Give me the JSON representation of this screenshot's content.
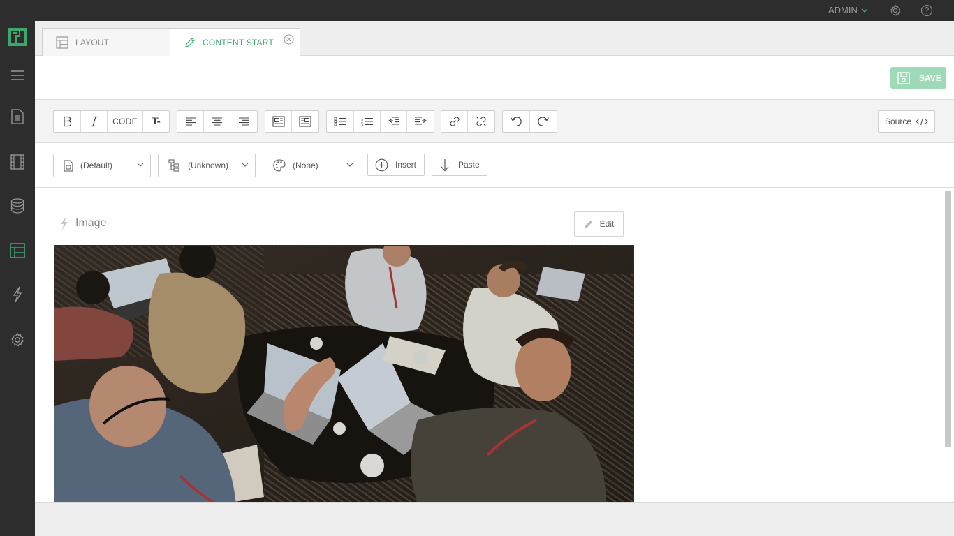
{
  "topbar": {
    "user_label": "ADMIN",
    "icons": [
      "chevron-down-icon",
      "gear-icon",
      "help-icon"
    ]
  },
  "sidebar": {
    "items": [
      {
        "name": "menu",
        "icon": "hamburger-icon",
        "active": false
      },
      {
        "name": "pages",
        "icon": "document-icon",
        "active": false
      },
      {
        "name": "media",
        "icon": "film-icon",
        "active": false
      },
      {
        "name": "data",
        "icon": "database-icon",
        "active": false
      },
      {
        "name": "layouts",
        "icon": "layout-icon",
        "active": true
      },
      {
        "name": "actions",
        "icon": "lightning-icon",
        "active": false
      },
      {
        "name": "settings",
        "icon": "gear-icon",
        "active": false
      }
    ]
  },
  "tabs": [
    {
      "label": "LAYOUT",
      "active": false
    },
    {
      "label": "CONTENT START",
      "active": true
    }
  ],
  "header": {
    "save_label": "SAVE"
  },
  "toolbar": {
    "code_label": "CODE",
    "clear_format_label": "T-",
    "source_label": "Source"
  },
  "toolbar2": {
    "style_select": "(Default)",
    "structure_select": "(Unknown)",
    "palette_select": "(None)",
    "insert_label": "Insert",
    "paste_label": "Paste"
  },
  "block": {
    "title": "Image",
    "edit_label": "Edit"
  },
  "colors": {
    "accent": "#3aa86d",
    "save_bg": "#9fdab8",
    "sidebar_bg": "#2d2d2d"
  }
}
